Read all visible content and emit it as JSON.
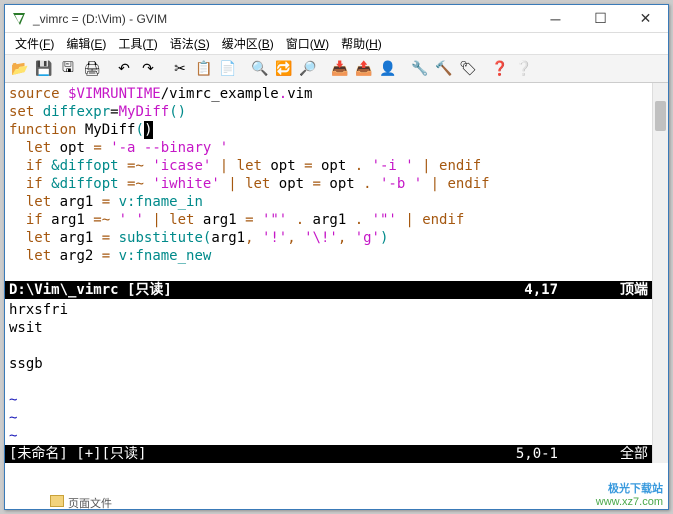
{
  "title": "_vimrc = (D:\\Vim) - GVIM",
  "menus": [
    {
      "label": "文件",
      "key": "F"
    },
    {
      "label": "编辑",
      "key": "E"
    },
    {
      "label": "工具",
      "key": "T"
    },
    {
      "label": "语法",
      "key": "S"
    },
    {
      "label": "缓冲区",
      "key": "B"
    },
    {
      "label": "窗口",
      "key": "W"
    },
    {
      "label": "帮助",
      "key": "H"
    }
  ],
  "toolbar_icons": [
    "open",
    "save",
    "saveall",
    "print",
    "sep",
    "undo",
    "redo",
    "sep",
    "cut",
    "copy",
    "paste",
    "sep",
    "find",
    "replace",
    "findnext",
    "sep",
    "load",
    "session",
    "run",
    "sep",
    "shell",
    "make",
    "tags",
    "sep",
    "help",
    "findhelp"
  ],
  "code_tokens": [
    [
      [
        "brown",
        "source"
      ],
      [
        "",
        " "
      ],
      [
        "magenta",
        "$VIMRUNTIME"
      ],
      [
        "",
        "/vimrc_example"
      ],
      [
        "magenta",
        "."
      ],
      [
        "",
        "vim"
      ]
    ],
    [
      [
        "",
        ""
      ]
    ],
    [
      [
        "brown",
        "set"
      ],
      [
        "",
        " "
      ],
      [
        "teal",
        "diffexpr"
      ],
      [
        "",
        "="
      ],
      [
        "magenta",
        "MyDiff"
      ],
      [
        "teal",
        "()"
      ]
    ],
    [
      [
        "brown",
        "function"
      ],
      [
        "",
        " MyDiff"
      ],
      [
        "teal",
        "("
      ],
      [
        "cursor",
        ")"
      ]
    ],
    [
      [
        "",
        "  "
      ],
      [
        "brown",
        "let"
      ],
      [
        "",
        " opt "
      ],
      [
        "brown",
        "="
      ],
      [
        "",
        " "
      ],
      [
        "magenta",
        "'-a --binary '"
      ]
    ],
    [
      [
        "",
        "  "
      ],
      [
        "brown",
        "if"
      ],
      [
        "",
        " "
      ],
      [
        "teal",
        "&diffopt"
      ],
      [
        "",
        " "
      ],
      [
        "brown",
        "=~"
      ],
      [
        "",
        " "
      ],
      [
        "magenta",
        "'icase'"
      ],
      [
        "",
        " "
      ],
      [
        "brown",
        "|"
      ],
      [
        "",
        " "
      ],
      [
        "brown",
        "let"
      ],
      [
        "",
        " opt "
      ],
      [
        "brown",
        "="
      ],
      [
        "",
        " opt "
      ],
      [
        "brown",
        "."
      ],
      [
        "",
        " "
      ],
      [
        "magenta",
        "'-i '"
      ],
      [
        "",
        " "
      ],
      [
        "brown",
        "|"
      ],
      [
        "",
        " "
      ],
      [
        "brown",
        "endif"
      ]
    ],
    [
      [
        "",
        "  "
      ],
      [
        "brown",
        "if"
      ],
      [
        "",
        " "
      ],
      [
        "teal",
        "&diffopt"
      ],
      [
        "",
        " "
      ],
      [
        "brown",
        "=~"
      ],
      [
        "",
        " "
      ],
      [
        "magenta",
        "'iwhite'"
      ],
      [
        "",
        " "
      ],
      [
        "brown",
        "|"
      ],
      [
        "",
        " "
      ],
      [
        "brown",
        "let"
      ],
      [
        "",
        " opt "
      ],
      [
        "brown",
        "="
      ],
      [
        "",
        " opt "
      ],
      [
        "brown",
        "."
      ],
      [
        "",
        " "
      ],
      [
        "magenta",
        "'-b '"
      ],
      [
        "",
        " "
      ],
      [
        "brown",
        "|"
      ],
      [
        "",
        " "
      ],
      [
        "brown",
        "endif"
      ]
    ],
    [
      [
        "",
        "  "
      ],
      [
        "brown",
        "let"
      ],
      [
        "",
        " arg1 "
      ],
      [
        "brown",
        "="
      ],
      [
        "",
        " "
      ],
      [
        "teal",
        "v:fname_in"
      ]
    ],
    [
      [
        "",
        "  "
      ],
      [
        "brown",
        "if"
      ],
      [
        "",
        " arg1 "
      ],
      [
        "brown",
        "=~"
      ],
      [
        "",
        " "
      ],
      [
        "magenta",
        "' '"
      ],
      [
        "",
        " "
      ],
      [
        "brown",
        "|"
      ],
      [
        "",
        " "
      ],
      [
        "brown",
        "let"
      ],
      [
        "",
        " arg1 "
      ],
      [
        "brown",
        "="
      ],
      [
        "",
        " "
      ],
      [
        "magenta",
        "'\"'"
      ],
      [
        "",
        " "
      ],
      [
        "brown",
        "."
      ],
      [
        "",
        " arg1 "
      ],
      [
        "brown",
        "."
      ],
      [
        "",
        " "
      ],
      [
        "magenta",
        "'\"'"
      ],
      [
        "",
        " "
      ],
      [
        "brown",
        "|"
      ],
      [
        "",
        " "
      ],
      [
        "brown",
        "endif"
      ]
    ],
    [
      [
        "",
        "  "
      ],
      [
        "brown",
        "let"
      ],
      [
        "",
        " arg1 "
      ],
      [
        "brown",
        "="
      ],
      [
        "",
        " "
      ],
      [
        "teal",
        "substitute"
      ],
      [
        "teal",
        "("
      ],
      [
        "",
        "arg1"
      ],
      [
        "brown",
        ","
      ],
      [
        "",
        " "
      ],
      [
        "magenta",
        "'!'"
      ],
      [
        "brown",
        ","
      ],
      [
        "",
        " "
      ],
      [
        "magenta",
        "'\\!'"
      ],
      [
        "brown",
        ","
      ],
      [
        "",
        " "
      ],
      [
        "magenta",
        "'g'"
      ],
      [
        "teal",
        ")"
      ]
    ],
    [
      [
        "",
        "  "
      ],
      [
        "brown",
        "let"
      ],
      [
        "",
        " arg2 "
      ],
      [
        "brown",
        "="
      ],
      [
        "",
        " "
      ],
      [
        "teal",
        "v:fname_new"
      ]
    ]
  ],
  "status1": {
    "file": "D:\\Vim\\_vimrc [只读]",
    "pos": "4,17",
    "perc": "顶端"
  },
  "pane2_lines": [
    "hrxsfri",
    "wsit",
    "",
    "ssgb",
    "",
    "~",
    "~",
    "~",
    "~",
    "~"
  ],
  "status2": {
    "file": "[未命名] [+][只读]",
    "pos": "5,0-1",
    "perc": "全部"
  },
  "watermark": {
    "line1": "极光下载站",
    "line2": "www.xz7.com"
  },
  "taskline": {
    "label": "页面文件"
  }
}
